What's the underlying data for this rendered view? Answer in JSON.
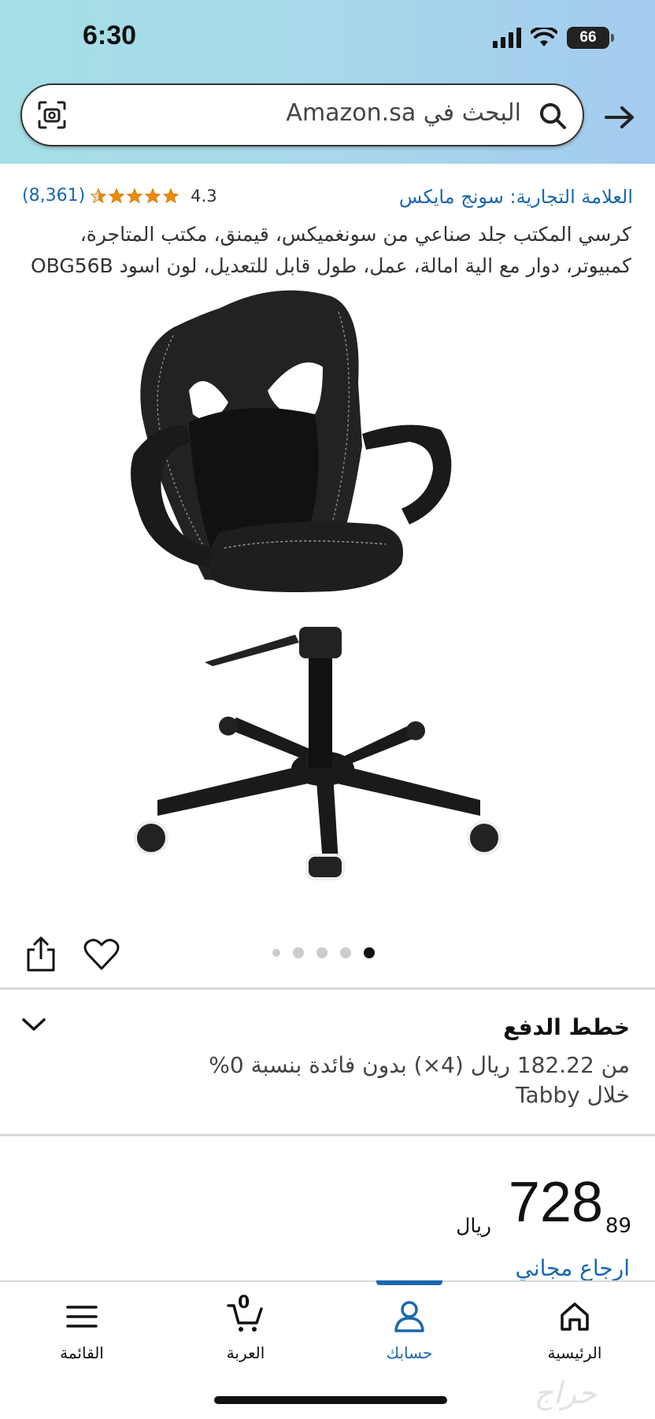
{
  "status_bar": {
    "time": "6:30",
    "battery": "66"
  },
  "search": {
    "placeholder": "البحث في Amazon.sa"
  },
  "product": {
    "brand": "العلامة التجارية: سونج مايكس",
    "rating_value": "4.3",
    "rating_stars": 4.5,
    "rating_count": "(8,361)",
    "title": "كرسي المكتب جلد صناعي من سونغميكس، قيمنق، مكتب المتاجرة، كمبيوتر، دوار مع الية امالة، عمل، طول قابل للتعديل، لون اسود OBG56B",
    "image_alt": "office-chair-image",
    "carousel_count": 5,
    "carousel_active": 4
  },
  "payment_plans": {
    "title": "خطط الدفع",
    "description": "من 182.22 ريال (4×) بدون فائدة بنسبة 0% خلال Tabby"
  },
  "price": {
    "whole": "728",
    "fraction": "89",
    "currency": "ريال"
  },
  "returns": {
    "label": "ارجاع مجاني"
  },
  "bottom_nav": {
    "items": [
      {
        "label": "الرئيسية",
        "icon": "home-icon"
      },
      {
        "label": "حسابك",
        "icon": "account-icon",
        "active": true
      },
      {
        "label": "العربة",
        "icon": "cart-icon",
        "count": "0"
      },
      {
        "label": "القائمة",
        "icon": "menu-icon"
      }
    ]
  },
  "colors": {
    "link": "#1a67b0",
    "star": "#f08804",
    "header_start": "#a4dfe6",
    "header_end": "#a3cbef"
  },
  "watermark": "حراج"
}
